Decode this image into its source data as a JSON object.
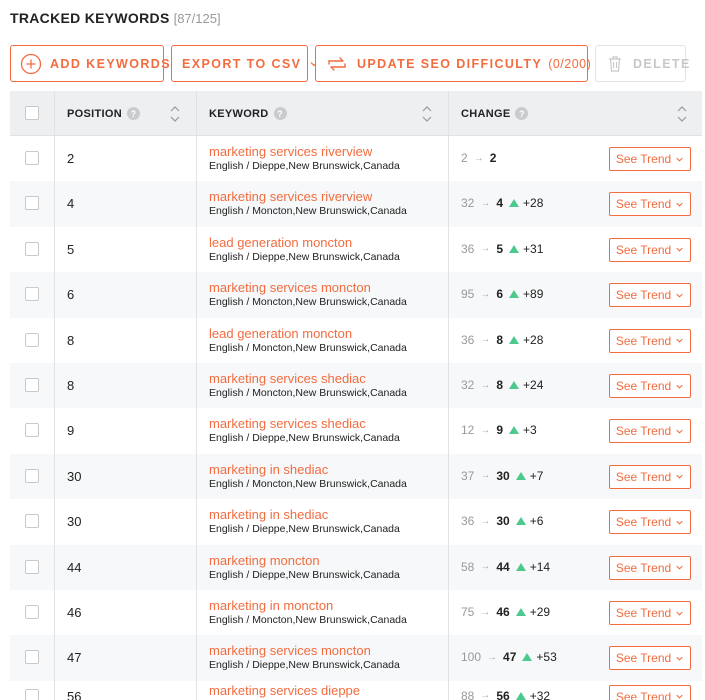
{
  "header": {
    "title": "TRACKED KEYWORDS",
    "count": "[87/125]"
  },
  "toolbar": {
    "add_label": "ADD KEYWORDS",
    "export_label": "EXPORT TO CSV",
    "update_label": "UPDATE SEO DIFFICULTY",
    "update_count": "(0/200)",
    "delete_label": "DELETE"
  },
  "table": {
    "columns": {
      "position": "POSITION",
      "keyword": "KEYWORD",
      "change": "CHANGE"
    },
    "trend_label": "See Trend",
    "rows": [
      {
        "position": "2",
        "keyword": "marketing services riverview",
        "location": "English / Dieppe,New Brunswick,Canada",
        "old": "2",
        "new": "2",
        "delta": ""
      },
      {
        "position": "4",
        "keyword": "marketing services riverview",
        "location": "English / Moncton,New Brunswick,Canada",
        "old": "32",
        "new": "4",
        "delta": "+28"
      },
      {
        "position": "5",
        "keyword": "lead generation moncton",
        "location": "English / Dieppe,New Brunswick,Canada",
        "old": "36",
        "new": "5",
        "delta": "+31"
      },
      {
        "position": "6",
        "keyword": "marketing services moncton",
        "location": "English / Moncton,New Brunswick,Canada",
        "old": "95",
        "new": "6",
        "delta": "+89"
      },
      {
        "position": "8",
        "keyword": "lead generation moncton",
        "location": "English / Moncton,New Brunswick,Canada",
        "old": "36",
        "new": "8",
        "delta": "+28"
      },
      {
        "position": "8",
        "keyword": "marketing services shediac",
        "location": "English / Moncton,New Brunswick,Canada",
        "old": "32",
        "new": "8",
        "delta": "+24"
      },
      {
        "position": "9",
        "keyword": "marketing services shediac",
        "location": "English / Dieppe,New Brunswick,Canada",
        "old": "12",
        "new": "9",
        "delta": "+3"
      },
      {
        "position": "30",
        "keyword": "marketing in shediac",
        "location": "English / Moncton,New Brunswick,Canada",
        "old": "37",
        "new": "30",
        "delta": "+7"
      },
      {
        "position": "30",
        "keyword": "marketing in shediac",
        "location": "English / Dieppe,New Brunswick,Canada",
        "old": "36",
        "new": "30",
        "delta": "+6"
      },
      {
        "position": "44",
        "keyword": "marketing moncton",
        "location": "English / Dieppe,New Brunswick,Canada",
        "old": "58",
        "new": "44",
        "delta": "+14"
      },
      {
        "position": "46",
        "keyword": "marketing in moncton",
        "location": "English / Moncton,New Brunswick,Canada",
        "old": "75",
        "new": "46",
        "delta": "+29"
      },
      {
        "position": "47",
        "keyword": "marketing services moncton",
        "location": "English / Dieppe,New Brunswick,Canada",
        "old": "100",
        "new": "47",
        "delta": "+53"
      },
      {
        "position": "56",
        "keyword": "marketing services dieppe",
        "location": "",
        "old": "88",
        "new": "56",
        "delta": "+32"
      }
    ]
  },
  "colors": {
    "accent": "#f26c3f",
    "up": "#4cc98d"
  }
}
